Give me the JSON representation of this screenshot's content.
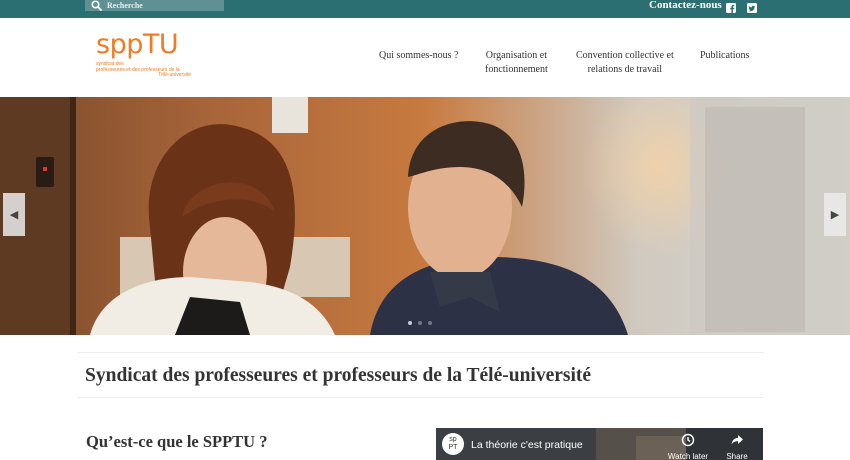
{
  "topbar": {
    "search_placeholder": "Recherche",
    "contact_label": "Contactez-nous",
    "social": [
      "facebook-icon",
      "twitter-icon"
    ]
  },
  "logo": {
    "wordmark": "sppTU",
    "tagline_lines": [
      "syndicat des",
      "professeures et des professeurs de la",
      "Télé-université"
    ]
  },
  "nav": {
    "items": [
      {
        "label_lines": [
          "Qui sommes-nous ?"
        ]
      },
      {
        "label_lines": [
          "Organisation et",
          "fonctionnement"
        ]
      },
      {
        "label_lines": [
          "Convention collective et",
          "relations de travail"
        ]
      },
      {
        "label_lines": [
          "Publications"
        ]
      }
    ]
  },
  "carousel": {
    "prev_icon": "chevron-left-icon",
    "next_icon": "chevron-right-icon",
    "slide_count": 3,
    "active_slide": 1
  },
  "main": {
    "page_title": "Syndicat des professeures et professeurs de la Télé-université",
    "section_title": "Qu’est-ce que le SPPTU ?"
  },
  "video": {
    "title": "La théorie c'est pratique",
    "watch_later_label": "Watch later",
    "share_label": "Share"
  },
  "colors": {
    "topbar": "#2b6f73",
    "brand_orange": "#f07b22",
    "text": "#333333"
  }
}
